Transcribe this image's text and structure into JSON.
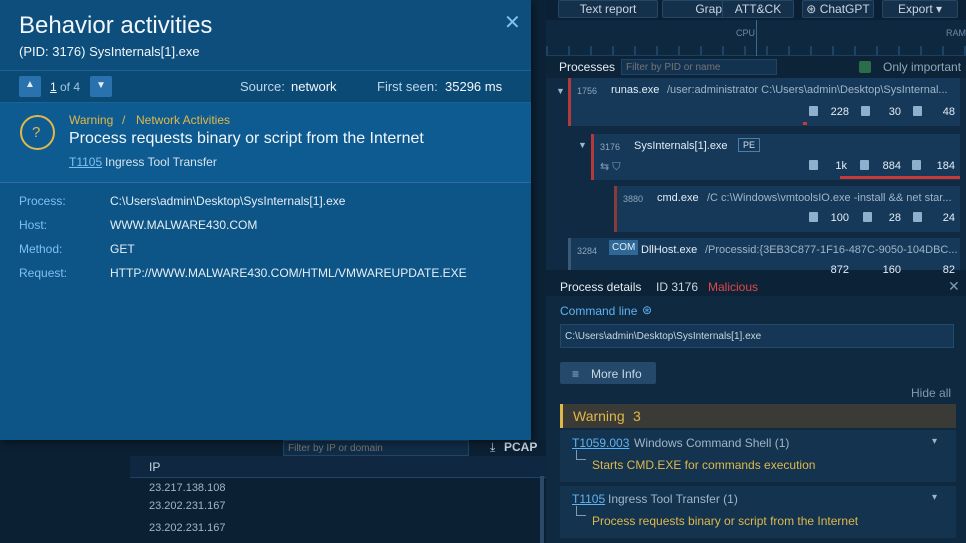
{
  "toolbar": {
    "text_report": "Text report",
    "graph": "Graph",
    "attck": "ATT&CK",
    "chatgpt": "ChatGPT",
    "export": "Export"
  },
  "cpu_label": "CPU",
  "ram_label": "RAM",
  "processes": {
    "title": "Processes",
    "filter_placeholder": "Filter by PID or name",
    "only_important": "Only important",
    "rows": [
      {
        "pid": "1756",
        "name": "runas.exe",
        "cmd": "/user:administrator C:\\Users\\admin\\Desktop\\SysInternal...",
        "s1": "228",
        "s2": "30",
        "s3": "48"
      },
      {
        "pid": "3176",
        "name": "SysInternals[1].exe",
        "badge": "PE",
        "s1": "1k",
        "s2": "884",
        "s3": "184"
      },
      {
        "pid": "3880",
        "name": "cmd.exe",
        "cmd": "/C c:\\Windows\\vmtoolsIO.exe -install && net star...",
        "s1": "100",
        "s2": "28",
        "s3": "24"
      },
      {
        "pid": "3284",
        "name": "DllHost.exe",
        "badge": "COM",
        "cmd": "/Processid:{3EB3C877-1F16-487C-9050-104DBC...",
        "s1": "872",
        "s2": "160",
        "s3": "82"
      }
    ]
  },
  "details": {
    "title": "Process details",
    "id": "ID 3176",
    "status": "Malicious",
    "cmd_label": "Command line",
    "cmd_value": "C:\\Users\\admin\\Desktop\\SysInternals[1].exe",
    "more_info": "More Info",
    "hide_all": "Hide all",
    "warning_label": "Warning",
    "warning_count": "3",
    "items": [
      {
        "code": "T1059.003",
        "name": "Windows Command Shell (1)",
        "desc": "Starts CMD.EXE for commands execution"
      },
      {
        "code": "T1105",
        "name": "Ingress Tool Transfer (1)",
        "desc": "Process requests binary or script from the Internet"
      }
    ]
  },
  "network": {
    "filter_placeholder": "Filter by IP or domain",
    "pcap": "PCAP",
    "ip_header": "IP",
    "ips": [
      "23.217.138.108",
      "23.202.231.167",
      "23.202.231.167"
    ]
  },
  "modal": {
    "title": "Behavior activities",
    "subtitle": "(PID: 3176) SysInternals[1].exe",
    "page_current": "1",
    "page_of": "of 4",
    "source_label": "Source:",
    "source_value": "network",
    "first_seen_label": "First seen:",
    "first_seen_value": "35296 ms",
    "severity": "Warning",
    "separator": "/",
    "category": "Network Activities",
    "alert_title": "Process requests binary or script from the Internet",
    "technique_code": "T1105",
    "technique_name": "Ingress Tool Transfer",
    "fields": [
      {
        "label": "Process:",
        "value": "C:\\Users\\admin\\Desktop\\SysInternals[1].exe"
      },
      {
        "label": "Host:",
        "value": "WWW.MALWARE430.COM"
      },
      {
        "label": "Method:",
        "value": "GET"
      },
      {
        "label": "Request:",
        "value": "HTTP://WWW.MALWARE430.COM/HTML/VMWAREUPDATE.EXE"
      }
    ]
  },
  "colors": {
    "warning": "#e0b84a",
    "malicious": "#e04848",
    "link": "#5fb3f0"
  }
}
